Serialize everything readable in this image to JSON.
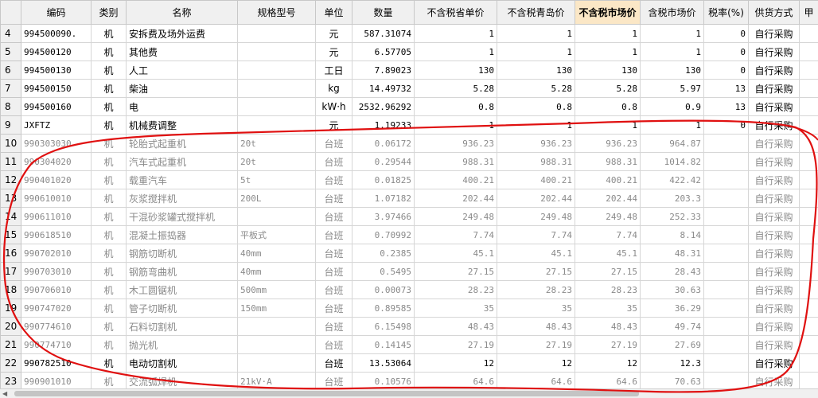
{
  "columns": [
    "",
    "编码",
    "类别",
    "名称",
    "规格型号",
    "单位",
    "数量",
    "不含税省单价",
    "不含税青岛价",
    "不含税市场价",
    "含税市场价",
    "税率(%)",
    "供货方式",
    "甲"
  ],
  "rows": [
    {
      "n": "4",
      "code": "994500090.",
      "type": "机",
      "name": "安拆费及场外运费",
      "spec": "",
      "unit": "元",
      "qty": "587.31074",
      "p1": "1",
      "p2": "1",
      "p3": "1",
      "p4": "1",
      "tax": "0",
      "supply": "自行采购",
      "dim": false
    },
    {
      "n": "5",
      "code": "994500120",
      "type": "机",
      "name": "其他费",
      "spec": "",
      "unit": "元",
      "qty": "6.57705",
      "p1": "1",
      "p2": "1",
      "p3": "1",
      "p4": "1",
      "tax": "0",
      "supply": "自行采购",
      "dim": false
    },
    {
      "n": "6",
      "code": "994500130",
      "type": "机",
      "name": "人工",
      "spec": "",
      "unit": "工日",
      "qty": "7.89023",
      "p1": "130",
      "p2": "130",
      "p3": "130",
      "p4": "130",
      "tax": "0",
      "supply": "自行采购",
      "dim": false
    },
    {
      "n": "7",
      "code": "994500150",
      "type": "机",
      "name": "柴油",
      "spec": "",
      "unit": "kg",
      "qty": "14.49732",
      "p1": "5.28",
      "p2": "5.28",
      "p3": "5.28",
      "p4": "5.97",
      "tax": "13",
      "supply": "自行采购",
      "dim": false
    },
    {
      "n": "8",
      "code": "994500160",
      "type": "机",
      "name": "电",
      "spec": "",
      "unit": "kW·h",
      "qty": "2532.96292",
      "p1": "0.8",
      "p2": "0.8",
      "p3": "0.8",
      "p4": "0.9",
      "tax": "13",
      "supply": "自行采购",
      "dim": false
    },
    {
      "n": "9",
      "code": "JXFTZ",
      "type": "机",
      "name": "机械费调整",
      "spec": "",
      "unit": "元",
      "qty": "1.19233",
      "p1": "1",
      "p2": "1",
      "p3": "1",
      "p4": "1",
      "tax": "0",
      "supply": "自行采购",
      "dim": false
    },
    {
      "n": "10",
      "code": "990303030",
      "type": "机",
      "name": "轮胎式起重机",
      "spec": "20t",
      "unit": "台班",
      "qty": "0.06172",
      "p1": "936.23",
      "p2": "936.23",
      "p3": "936.23",
      "p4": "964.87",
      "tax": "",
      "supply": "自行采购",
      "dim": true
    },
    {
      "n": "11",
      "code": "990304020",
      "type": "机",
      "name": "汽车式起重机",
      "spec": "20t",
      "unit": "台班",
      "qty": "0.29544",
      "p1": "988.31",
      "p2": "988.31",
      "p3": "988.31",
      "p4": "1014.82",
      "tax": "",
      "supply": "自行采购",
      "dim": true
    },
    {
      "n": "12",
      "code": "990401020",
      "type": "机",
      "name": "载重汽车",
      "spec": "5t",
      "unit": "台班",
      "qty": "0.01825",
      "p1": "400.21",
      "p2": "400.21",
      "p3": "400.21",
      "p4": "422.42",
      "tax": "",
      "supply": "自行采购",
      "dim": true
    },
    {
      "n": "13",
      "code": "990610010",
      "type": "机",
      "name": "灰浆搅拌机",
      "spec": "200L",
      "unit": "台班",
      "qty": "1.07182",
      "p1": "202.44",
      "p2": "202.44",
      "p3": "202.44",
      "p4": "203.3",
      "tax": "",
      "supply": "自行采购",
      "dim": true
    },
    {
      "n": "14",
      "code": "990611010",
      "type": "机",
      "name": "干混砂浆罐式搅拌机",
      "spec": "",
      "unit": "台班",
      "qty": "3.97466",
      "p1": "249.48",
      "p2": "249.48",
      "p3": "249.48",
      "p4": "252.33",
      "tax": "",
      "supply": "自行采购",
      "dim": true
    },
    {
      "n": "15",
      "code": "990618510",
      "type": "机",
      "name": "混凝土振捣器",
      "spec": "平板式",
      "unit": "台班",
      "qty": "0.70992",
      "p1": "7.74",
      "p2": "7.74",
      "p3": "7.74",
      "p4": "8.14",
      "tax": "",
      "supply": "自行采购",
      "dim": true
    },
    {
      "n": "16",
      "code": "990702010",
      "type": "机",
      "name": "钢筋切断机",
      "spec": "40mm",
      "unit": "台班",
      "qty": "0.2385",
      "p1": "45.1",
      "p2": "45.1",
      "p3": "45.1",
      "p4": "48.31",
      "tax": "",
      "supply": "自行采购",
      "dim": true
    },
    {
      "n": "17",
      "code": "990703010",
      "type": "机",
      "name": "钢筋弯曲机",
      "spec": "40mm",
      "unit": "台班",
      "qty": "0.5495",
      "p1": "27.15",
      "p2": "27.15",
      "p3": "27.15",
      "p4": "28.43",
      "tax": "",
      "supply": "自行采购",
      "dim": true
    },
    {
      "n": "18",
      "code": "990706010",
      "type": "机",
      "name": "木工圆锯机",
      "spec": "500mm",
      "unit": "台班",
      "qty": "0.00073",
      "p1": "28.23",
      "p2": "28.23",
      "p3": "28.23",
      "p4": "30.63",
      "tax": "",
      "supply": "自行采购",
      "dim": true
    },
    {
      "n": "19",
      "code": "990747020",
      "type": "机",
      "name": "管子切断机",
      "spec": "150mm",
      "unit": "台班",
      "qty": "0.89585",
      "p1": "35",
      "p2": "35",
      "p3": "35",
      "p4": "36.29",
      "tax": "",
      "supply": "自行采购",
      "dim": true
    },
    {
      "n": "20",
      "code": "990774610",
      "type": "机",
      "name": "石料切割机",
      "spec": "",
      "unit": "台班",
      "qty": "6.15498",
      "p1": "48.43",
      "p2": "48.43",
      "p3": "48.43",
      "p4": "49.74",
      "tax": "",
      "supply": "自行采购",
      "dim": true
    },
    {
      "n": "21",
      "code": "990774710",
      "type": "机",
      "name": "抛光机",
      "spec": "",
      "unit": "台班",
      "qty": "0.14145",
      "p1": "27.19",
      "p2": "27.19",
      "p3": "27.19",
      "p4": "27.69",
      "tax": "",
      "supply": "自行采购",
      "dim": true
    },
    {
      "n": "22",
      "code": "990782510",
      "type": "机",
      "name": "电动切割机",
      "spec": "",
      "unit": "台班",
      "qty": "13.53064",
      "p1": "12",
      "p2": "12",
      "p3": "12",
      "p4": "12.3",
      "tax": "",
      "supply": "自行采购",
      "dim": false
    },
    {
      "n": "23",
      "code": "990901010",
      "type": "机",
      "name": "交流弧焊机",
      "spec": "21kV·A",
      "unit": "台班",
      "qty": "0.10576",
      "p1": "64.6",
      "p2": "64.6",
      "p3": "64.6",
      "p4": "70.63",
      "tax": "",
      "supply": "自行采购",
      "dim": true
    }
  ],
  "colors": {
    "header_bg": "#f0f0f0",
    "highlight_header_bg": "#fbe7c6",
    "annotation": "#e01010",
    "dim_text": "#8a8a8a"
  }
}
